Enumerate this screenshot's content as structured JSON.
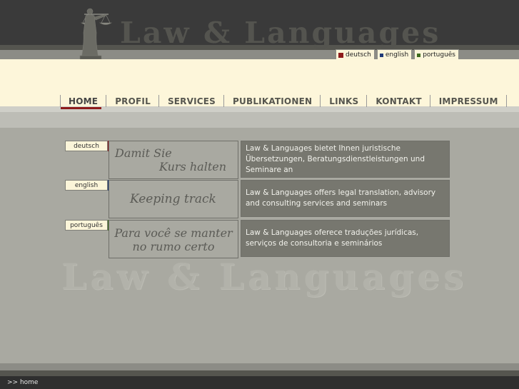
{
  "header": {
    "brand": "Law & Languages",
    "logo_icon": "justitia-statue-icon"
  },
  "language_tabs": [
    {
      "label": "deutsch",
      "color": "#8e1b1b"
    },
    {
      "label": "english",
      "color": "#1f3a78"
    },
    {
      "label": "português",
      "color": "#3f6b1e"
    }
  ],
  "nav": {
    "items": [
      {
        "label": "HOME",
        "active": true
      },
      {
        "label": "PROFIL"
      },
      {
        "label": "SERVICES"
      },
      {
        "label": "PUBLIKATIONEN"
      },
      {
        "label": "LINKS"
      },
      {
        "label": "KONTAKT"
      },
      {
        "label": "IMPRESSUM"
      }
    ],
    "active_color": "#8e1b1b"
  },
  "sections": [
    {
      "lang": "deutsch",
      "marker_color": "#8e1b1b",
      "slogan_line1": "Damit Sie",
      "slogan_line2": "Kurs halten",
      "description": "Law & Languages bietet Ihnen juristische Übersetzungen, Beratungsdienstleistungen und Seminare an"
    },
    {
      "lang": "english",
      "marker_color": "#1f3a78",
      "slogan_line1": "Keeping track",
      "slogan_line2": "",
      "description": "Law & Languages offers legal translation, advisory and consulting services and seminars"
    },
    {
      "lang": "português",
      "marker_color": "#3f6b1e",
      "slogan_line1": "Para você se manter",
      "slogan_line2": "no rumo certo",
      "description": "Law & Languages oferece traduções jurídicas, serviços de consultoria e seminários"
    }
  ],
  "watermark": "Law & Languages",
  "footer": {
    "breadcrumb": ">> home"
  }
}
